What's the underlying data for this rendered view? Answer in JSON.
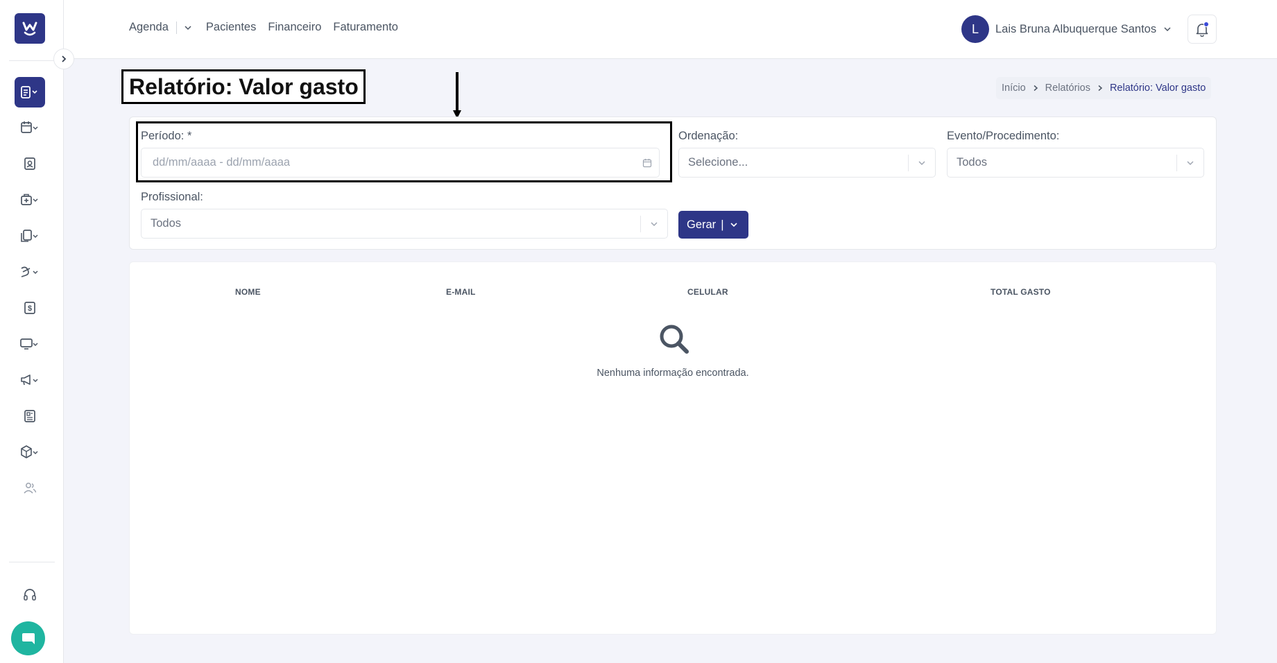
{
  "nav": {
    "agenda": "Agenda",
    "pacientes": "Pacientes",
    "financeiro": "Financeiro",
    "faturamento": "Faturamento"
  },
  "user": {
    "initial": "L",
    "name": "Lais Bruna Albuquerque Santos"
  },
  "page": {
    "title": "Relatório: Valor gasto"
  },
  "breadcrumb": {
    "items": [
      "Início",
      "Relatórios",
      "Relatório: Valor gasto"
    ]
  },
  "filters": {
    "periodo": {
      "label": "Período: *",
      "placeholder": "dd/mm/aaaa - dd/mm/aaaa"
    },
    "ordenacao": {
      "label": "Ordenação:",
      "value": "Selecione..."
    },
    "evento": {
      "label": "Evento/Procedimento:",
      "value": "Todos"
    },
    "profissional": {
      "label": "Profissional:",
      "value": "Todos"
    },
    "gerar_label": "Gerar"
  },
  "table": {
    "columns": [
      "NOME",
      "E-MAIL",
      "CELULAR",
      "TOTAL GASTO"
    ],
    "empty_message": "Nenhuma informação encontrada."
  },
  "colors": {
    "brand": "#2e3687",
    "chat": "#1fb5a0",
    "background": "#f3f4fa"
  }
}
